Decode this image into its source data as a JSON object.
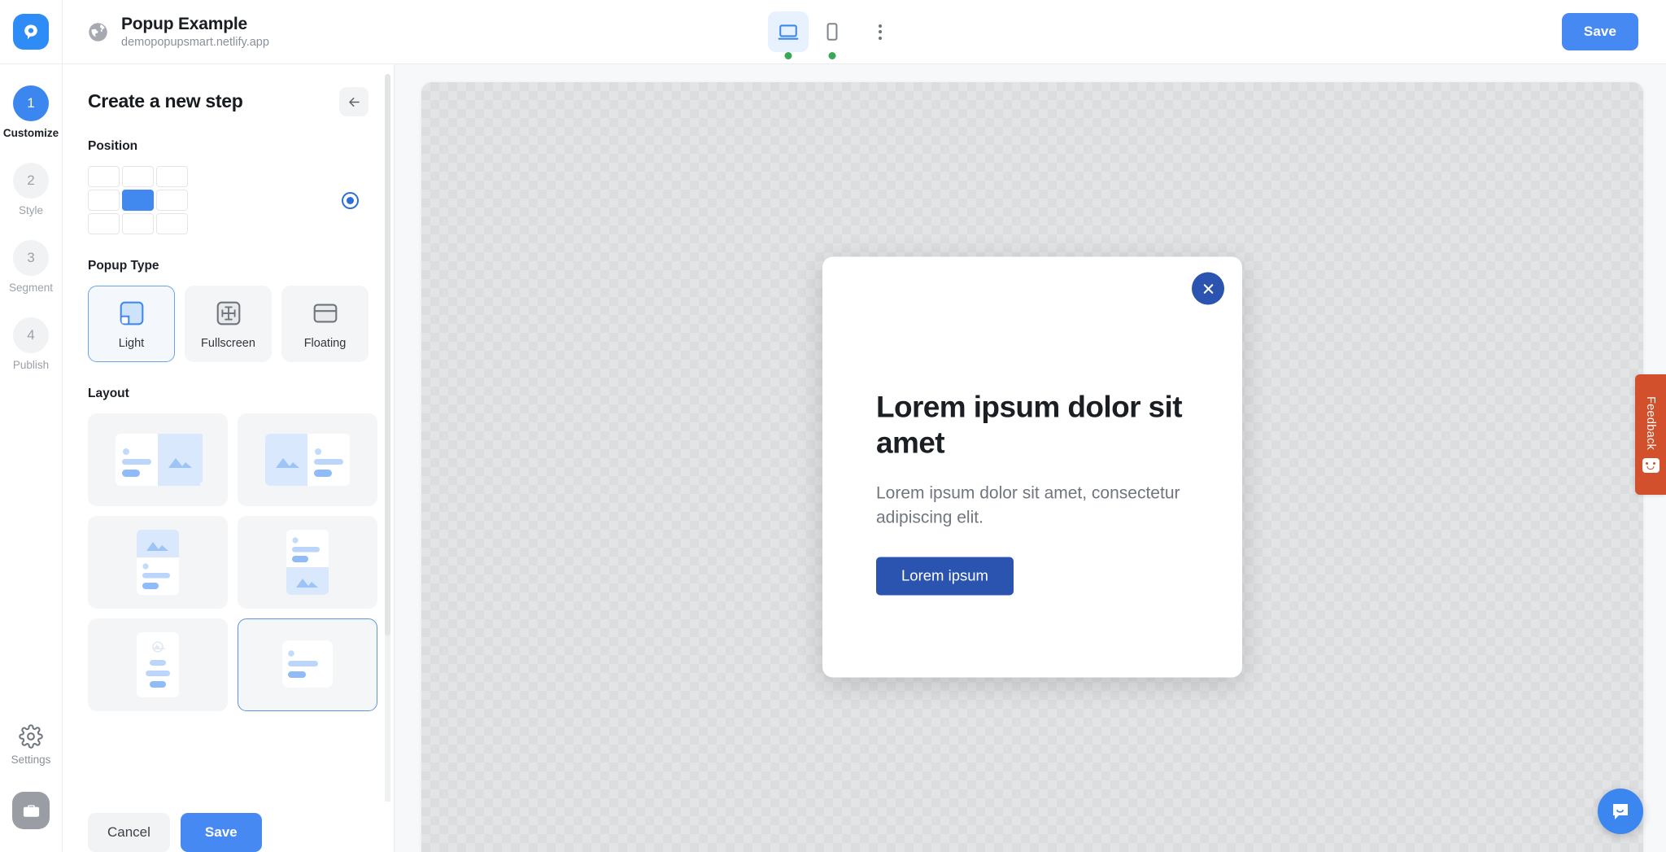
{
  "topbar": {
    "brand_icon": "popupsmart-logo-icon",
    "site_icon": "globe-icon",
    "site_title": "Popup Example",
    "site_url": "demopopupsmart.netlify.app",
    "devices": [
      {
        "icon": "desktop-icon",
        "name": "desktop",
        "active": true,
        "status_dot": "#3aa757"
      },
      {
        "icon": "mobile-icon",
        "name": "mobile",
        "active": false,
        "status_dot": "#3aa757"
      }
    ],
    "more_icon": "kebab-menu-icon",
    "save_label": "Save",
    "save_color": "#4689f3"
  },
  "rail": {
    "steps": [
      {
        "number": "1",
        "label": "Customize",
        "active": true
      },
      {
        "number": "2",
        "label": "Style",
        "active": false
      },
      {
        "number": "3",
        "label": "Segment",
        "active": false
      },
      {
        "number": "4",
        "label": "Publish",
        "active": false
      }
    ],
    "settings_icon": "gear-icon",
    "settings_label": "Settings",
    "briefcase_icon": "briefcase-icon"
  },
  "panel": {
    "title": "Create a new step",
    "back_icon": "arrow-left-icon",
    "position": {
      "label": "Position",
      "cells": [
        {
          "name": "top-left",
          "selected": false
        },
        {
          "name": "top-center",
          "selected": false
        },
        {
          "name": "top-right",
          "selected": false
        },
        {
          "name": "middle-left",
          "selected": false
        },
        {
          "name": "middle-center",
          "selected": true
        },
        {
          "name": "middle-right",
          "selected": false
        },
        {
          "name": "bottom-left",
          "selected": false
        },
        {
          "name": "bottom-center",
          "selected": false
        },
        {
          "name": "bottom-right",
          "selected": false
        }
      ],
      "radio_checked": true,
      "accent": "#4189ef"
    },
    "popup_type": {
      "label": "Popup Type",
      "options": [
        {
          "label": "Light",
          "icon": "light-popup-icon",
          "selected": true
        },
        {
          "label": "Fullscreen",
          "icon": "fullscreen-popup-icon",
          "selected": false
        },
        {
          "label": "Floating",
          "icon": "floating-popup-icon",
          "selected": false
        }
      ]
    },
    "layout": {
      "label": "Layout",
      "options": [
        {
          "name": "content-left-image-right",
          "selected": false
        },
        {
          "name": "image-left-content-right",
          "selected": false
        },
        {
          "name": "image-top-content-bottom",
          "selected": false
        },
        {
          "name": "content-top-image-bottom",
          "selected": false
        },
        {
          "name": "centered-text-only",
          "selected": false
        },
        {
          "name": "left-aligned-text-only",
          "selected": true
        }
      ]
    },
    "footer": {
      "cancel_label": "Cancel",
      "save_label": "Save"
    }
  },
  "preview": {
    "popup": {
      "close_icon": "close-x-icon",
      "heading": "Lorem ipsum dolor sit amet",
      "body": "Lorem ipsum dolor sit amet, consectetur adipiscing elit.",
      "cta_label": "Lorem ipsum",
      "cta_color": "#2b53b0"
    }
  },
  "feedback": {
    "label": "Feedback",
    "icon": "smiley-face-icon",
    "color": "#d2502b"
  },
  "intercom": {
    "icon": "chat-bubble-icon",
    "color": "#3b87ef"
  }
}
